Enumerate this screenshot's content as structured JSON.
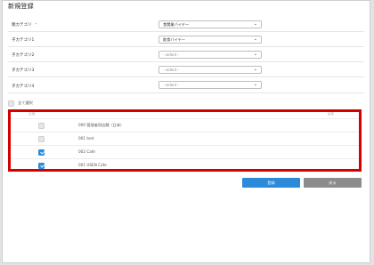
{
  "page_title": "新規登録",
  "form": {
    "rows": [
      {
        "label": "親カテゴリ",
        "required_mark": "*",
        "value": "食関業バイヤー",
        "placeholder": false
      },
      {
        "label": "子カテゴリ1",
        "required_mark": "",
        "value": "飲食バイヤー",
        "placeholder": false
      },
      {
        "label": "子カテゴリ2",
        "required_mark": "",
        "value": "- select -",
        "placeholder": true
      },
      {
        "label": "子カテゴリ3",
        "required_mark": "",
        "value": "- select -",
        "placeholder": true
      },
      {
        "label": "子カテゴリ4",
        "required_mark": "",
        "value": "- select -",
        "placeholder": true
      }
    ]
  },
  "select_all": {
    "label": "全て選択",
    "checked": false
  },
  "table": {
    "header_left": "店舗",
    "header_right": "結果",
    "rows": [
      {
        "label": "000 管理者用店舗（日本）",
        "checked": false
      },
      {
        "label": "001 test",
        "checked": false
      },
      {
        "label": "002 Cafe",
        "checked": true
      },
      {
        "label": "001 USEN Cafe",
        "checked": true
      }
    ]
  },
  "buttons": {
    "register": "登録",
    "back": "戻る"
  },
  "icons": {
    "dropdown": "chevron-down-icon",
    "checked": "checkmark-icon"
  },
  "colors": {
    "primary": "#2b8ad9",
    "secondary": "#8c8c8c",
    "highlight_border": "#d40000"
  }
}
